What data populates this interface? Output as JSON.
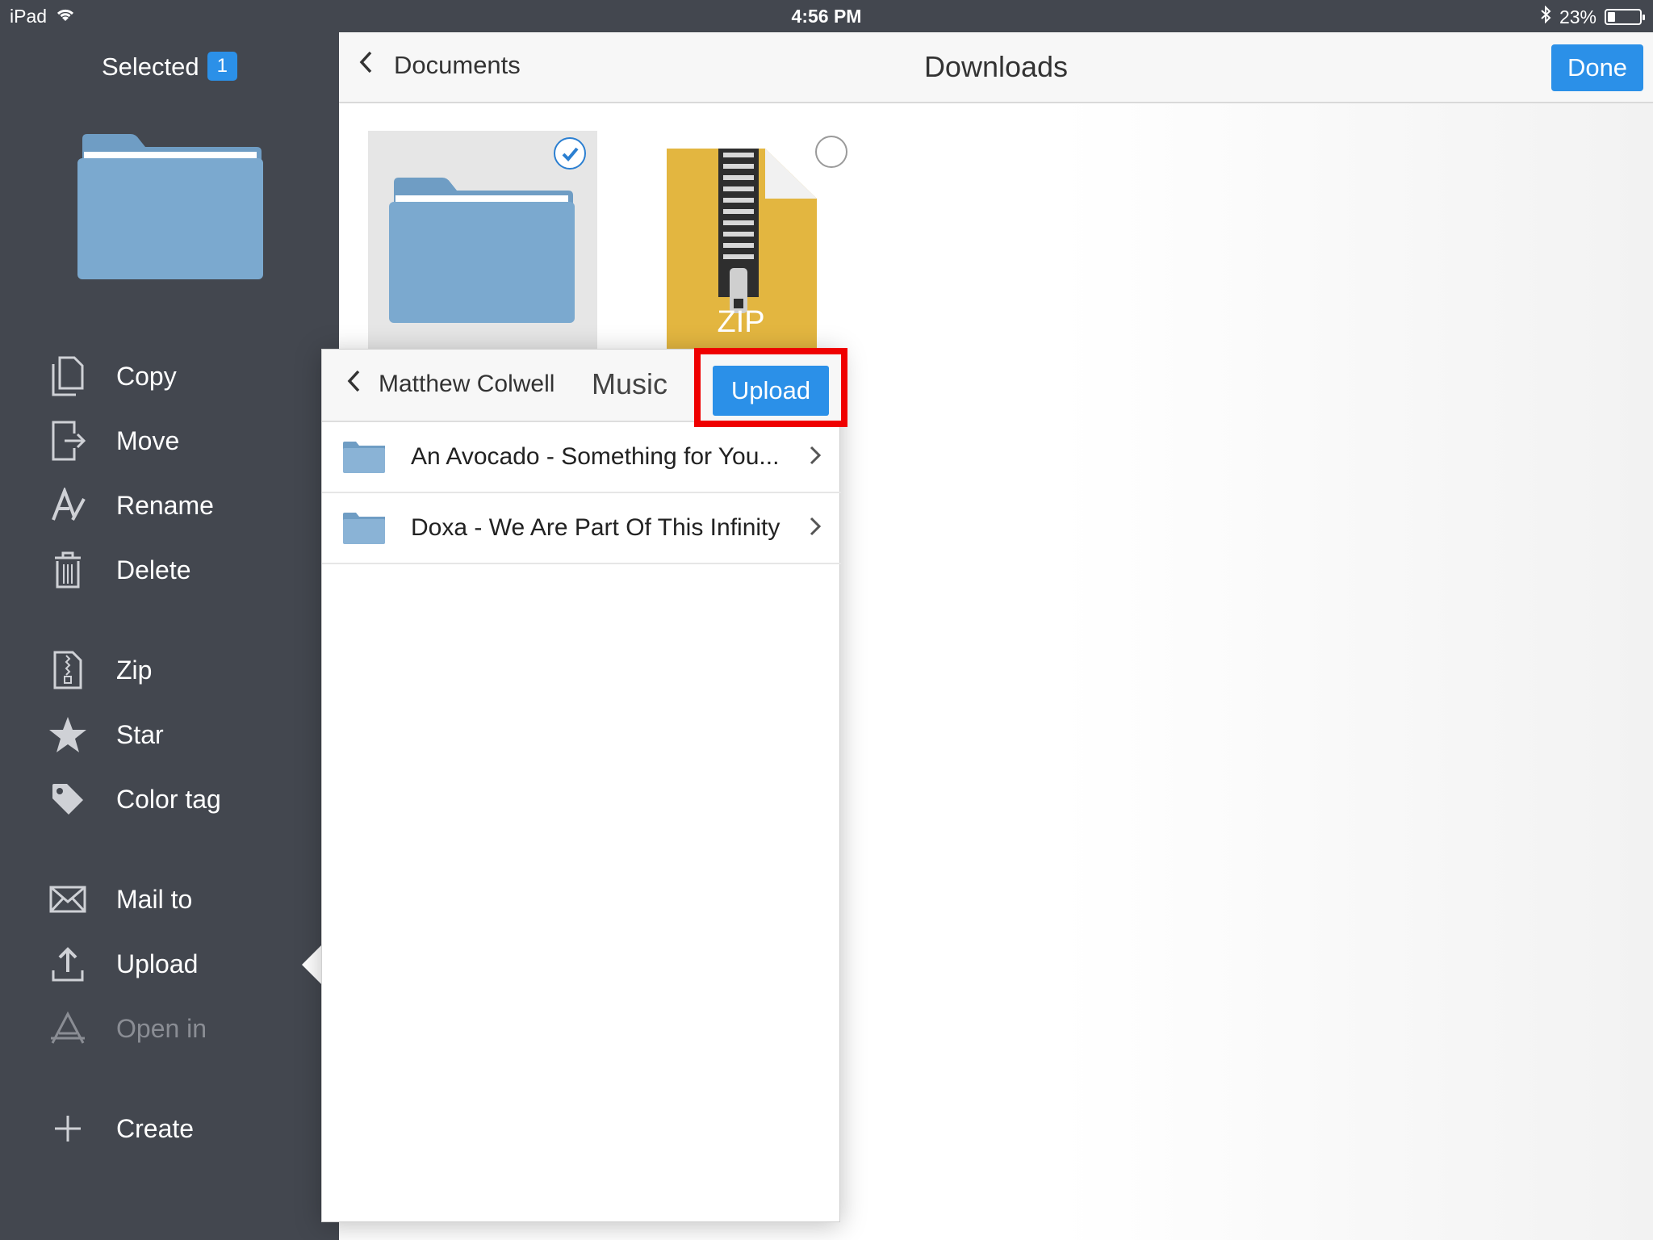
{
  "status_bar": {
    "device": "iPad",
    "time": "4:56 PM",
    "battery": "23%",
    "battery_level": 0.23,
    "icons": [
      "wifi-icon",
      "bluetooth-icon",
      "battery-icon"
    ]
  },
  "sidebar": {
    "selected_label": "Selected",
    "selected_count": "1",
    "items": [
      {
        "label": "Copy",
        "icon": "copy-icon"
      },
      {
        "label": "Move",
        "icon": "move-icon"
      },
      {
        "label": "Rename",
        "icon": "rename-icon"
      },
      {
        "label": "Delete",
        "icon": "trash-icon"
      },
      {
        "label": "Zip",
        "icon": "zip-icon"
      },
      {
        "label": "Star",
        "icon": "star-icon"
      },
      {
        "label": "Color tag",
        "icon": "tag-icon"
      },
      {
        "label": "Mail to",
        "icon": "mail-icon"
      },
      {
        "label": "Upload",
        "icon": "upload-icon"
      },
      {
        "label": "Open in",
        "icon": "open-in-icon",
        "disabled": true
      },
      {
        "label": "Create",
        "icon": "plus-icon"
      }
    ]
  },
  "navbar": {
    "back_label": "Documents",
    "title": "Downloads",
    "done_label": "Done"
  },
  "files": [
    {
      "type": "folder",
      "selected": true
    },
    {
      "type": "zip",
      "label": "ZIP",
      "selected": false
    }
  ],
  "popover": {
    "back_label": "Matthew Colwell",
    "title": "Music",
    "upload_label": "Upload",
    "rows": [
      {
        "label": "An Avocado - Something for You..."
      },
      {
        "label": "Doxa - We Are Part Of This Infinity"
      }
    ]
  },
  "colors": {
    "sidebar_bg": "#43474f",
    "accent_blue": "#2b90e8",
    "highlight_red": "#ef0000",
    "folder_blue": "#7ba9cf",
    "zip_gold": "#e3b640"
  }
}
